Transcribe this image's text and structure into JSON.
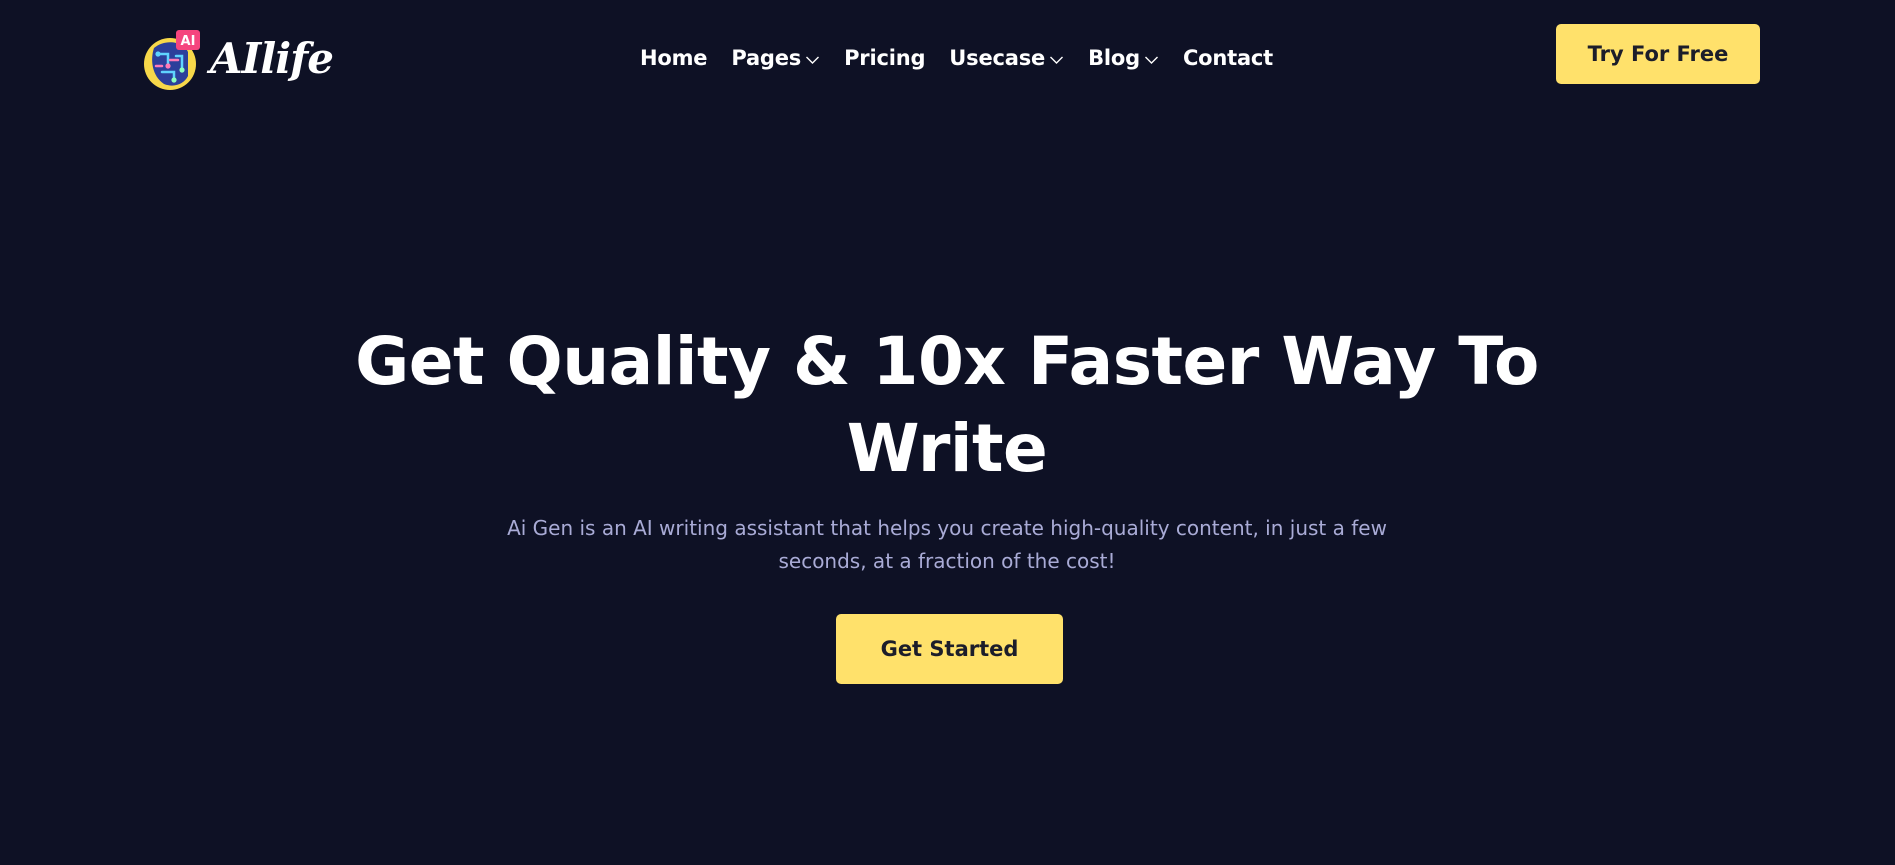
{
  "brand": {
    "logo_badge": "AI",
    "name": "AIlife"
  },
  "nav": {
    "items": [
      {
        "label": "Home",
        "has_dropdown": false
      },
      {
        "label": "Pages",
        "has_dropdown": true
      },
      {
        "label": "Pricing",
        "has_dropdown": false
      },
      {
        "label": "Usecase",
        "has_dropdown": true
      },
      {
        "label": "Blog",
        "has_dropdown": true
      },
      {
        "label": "Contact",
        "has_dropdown": false
      }
    ],
    "cta_label": "Try For Free"
  },
  "hero": {
    "title": "Get Quality & 10x Faster Way To Write",
    "subtitle": "Ai Gen is an AI writing assistant that helps you create high-quality content, in just a few seconds, at a fraction of the cost!",
    "cta_label": "Get Started"
  },
  "colors": {
    "background": "#0e1125",
    "accent": "#ffe16b",
    "button_text": "#1c1d2a",
    "subtitle_text": "#a9abd6"
  }
}
